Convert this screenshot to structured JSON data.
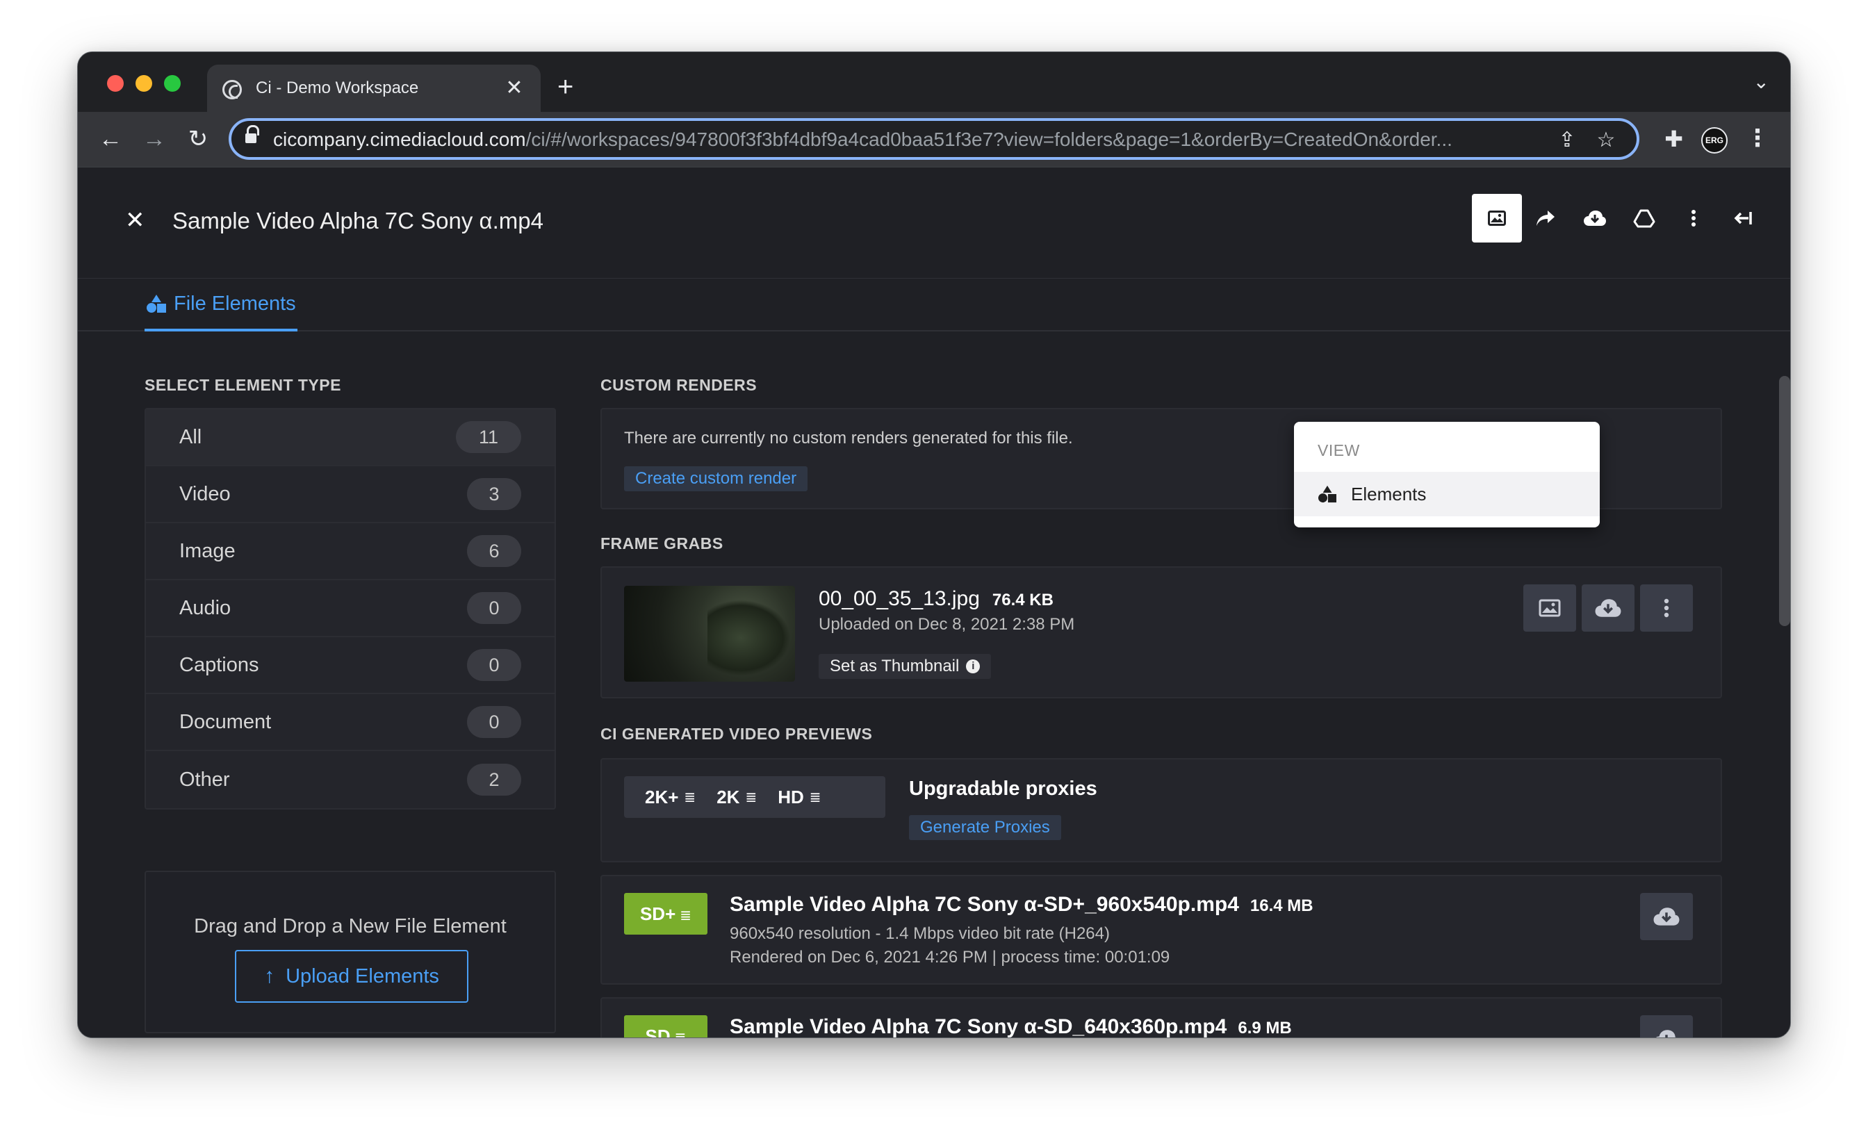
{
  "browser": {
    "tab_title": "Ci - Demo Workspace",
    "tab_close": "✕",
    "new_tab": "+",
    "url_host": "cicompany.cimediacloud.com",
    "url_path": "/ci/#/workspaces/947800f3f3bf4dbf9a4cad0baa51f3e7?view=folders&page=1&orderBy=CreatedOn&order..."
  },
  "header": {
    "file_title": "Sample Video Alpha 7C Sony α.mp4"
  },
  "tabs": {
    "file_elements": "File Elements"
  },
  "view_menu": {
    "label": "VIEW",
    "item": "Elements"
  },
  "left": {
    "section_label": "SELECT ELEMENT TYPE",
    "types": [
      {
        "label": "All",
        "count": "11"
      },
      {
        "label": "Video",
        "count": "3"
      },
      {
        "label": "Image",
        "count": "6"
      },
      {
        "label": "Audio",
        "count": "0"
      },
      {
        "label": "Captions",
        "count": "0"
      },
      {
        "label": "Document",
        "count": "0"
      },
      {
        "label": "Other",
        "count": "2"
      }
    ],
    "drop_text": "Drag and Drop a New File Element",
    "upload_label": "Upload Elements"
  },
  "custom_renders": {
    "section_label": "CUSTOM RENDERS",
    "empty_text": "There are currently no custom renders generated for this file.",
    "create_link": "Create custom render"
  },
  "frame_grabs": {
    "section_label": "FRAME GRABS",
    "file_name": "00_00_35_13.jpg",
    "file_size": "76.4 KB",
    "uploaded": "Uploaded on Dec 8, 2021  2:38 PM",
    "thumb_button": "Set as Thumbnail"
  },
  "previews": {
    "section_label": "CI GENERATED VIDEO PREVIEWS",
    "resolutions": [
      "2K+",
      "2K",
      "HD"
    ],
    "upgradable_title": "Upgradable proxies",
    "generate_link": "Generate Proxies",
    "items": [
      {
        "badge": "SD+",
        "name": "Sample Video Alpha 7C Sony α-SD+_960x540p.mp4",
        "size": "16.4 MB",
        "line1": "960x540 resolution - 1.4 Mbps video bit rate (H264)",
        "line2": "Rendered on Dec 6, 2021  4:26 PM | process time: 00:01:09"
      },
      {
        "badge": "SD",
        "name": "Sample Video Alpha 7C Sony α-SD_640x360p.mp4",
        "size": "6.9 MB"
      }
    ]
  },
  "colors": {
    "accent": "#4a9ff5",
    "sd_badge": "#7aae2c",
    "app_bg": "#1f2025"
  }
}
